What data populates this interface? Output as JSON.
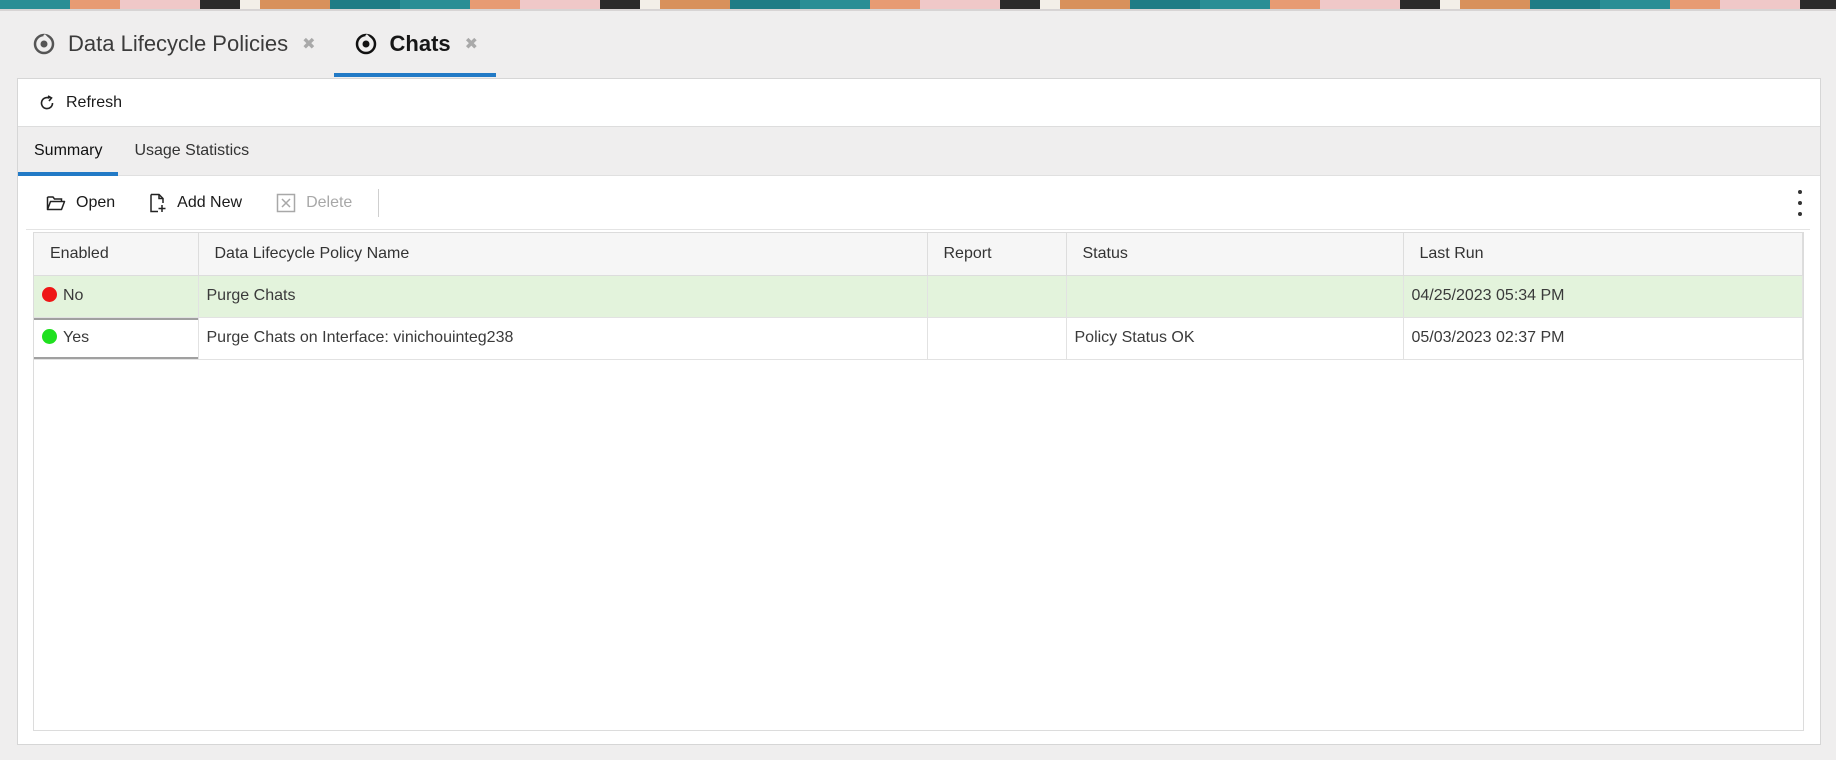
{
  "colors": {
    "accent": "#227ac6",
    "selected_row": "#e3f3dc",
    "status_no": "#ef1616",
    "status_yes": "#1fe01f"
  },
  "doc_tabs": [
    {
      "label": "Data Lifecycle Policies",
      "icon": "policy-icon",
      "close": "✖"
    },
    {
      "label": "Chats",
      "icon": "policy-icon",
      "close": "✖",
      "active": true
    }
  ],
  "refresh_label": "Refresh",
  "sub_tabs": [
    {
      "label": "Summary",
      "active": true
    },
    {
      "label": "Usage Statistics"
    }
  ],
  "toolbar": {
    "open_label": "Open",
    "add_new_label": "Add New",
    "delete_label": "Delete"
  },
  "table": {
    "columns": [
      "Enabled",
      "Data Lifecycle Policy Name",
      "Report",
      "Status",
      "Last Run"
    ],
    "rows": [
      {
        "enabled": "No",
        "enabled_color": "red",
        "name": "Purge Chats",
        "report": "",
        "status": "",
        "last_run": "04/25/2023 05:34 PM",
        "selected": true
      },
      {
        "enabled": "Yes",
        "enabled_color": "green",
        "name": "Purge Chats on Interface: vinichouinteg238",
        "report": "",
        "status": "Policy Status OK",
        "last_run": "05/03/2023 02:37 PM"
      }
    ]
  }
}
